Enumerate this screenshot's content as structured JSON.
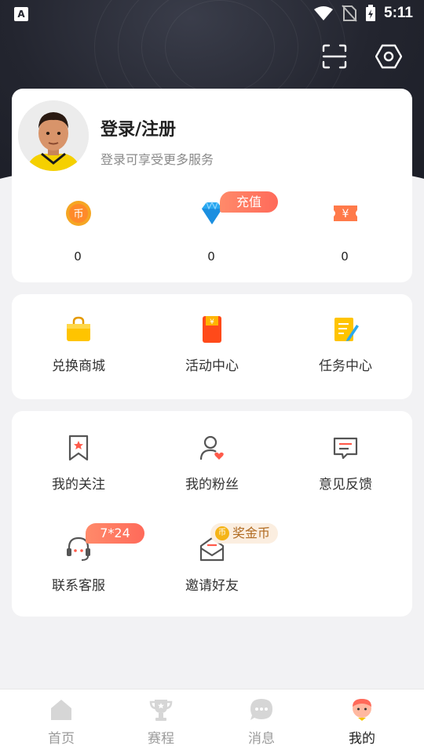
{
  "status_bar": {
    "time": "5:11",
    "app_icon_letter": "A"
  },
  "profile": {
    "title": "登录/注册",
    "subtitle": "登录可享受更多服务"
  },
  "stats": [
    {
      "icon": "coin-icon",
      "value": "0"
    },
    {
      "icon": "diamond-icon",
      "value": "0",
      "badge": "充值"
    },
    {
      "icon": "ticket-icon",
      "value": "0"
    }
  ],
  "shop_row": [
    {
      "icon": "shopping-bag-icon",
      "label": "兑换商城"
    },
    {
      "icon": "red-envelope-icon",
      "label": "活动中心"
    },
    {
      "icon": "task-note-icon",
      "label": "任务中心"
    }
  ],
  "more_row": [
    {
      "icon": "bookmark-star-icon",
      "label": "我的关注"
    },
    {
      "icon": "fans-icon",
      "label": "我的粉丝"
    },
    {
      "icon": "feedback-icon",
      "label": "意见反馈"
    },
    {
      "icon": "headset-icon",
      "label": "联系客服",
      "badge": "7*24"
    },
    {
      "icon": "invite-mail-icon",
      "label": "邀请好友",
      "badge": "奖金币"
    }
  ],
  "tabs": [
    {
      "label": "首页",
      "icon": "home-icon",
      "active": false
    },
    {
      "label": "赛程",
      "icon": "trophy-icon",
      "active": false
    },
    {
      "label": "消息",
      "icon": "message-icon",
      "active": false
    },
    {
      "label": "我的",
      "icon": "profile-avatar-icon",
      "active": true
    }
  ],
  "colors": {
    "header_bg": "#23252f",
    "accent": "#ff6a5a",
    "tab_inactive": "#9a9a9a",
    "coin_gold": "#f5a623"
  }
}
